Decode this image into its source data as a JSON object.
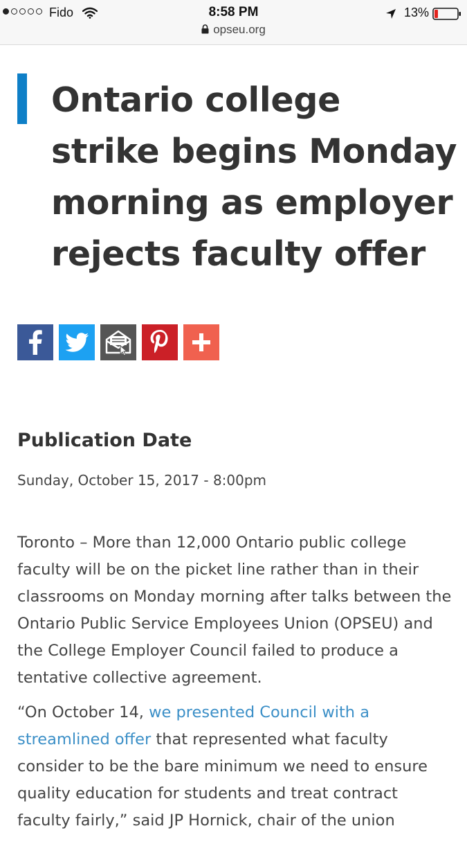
{
  "status_bar": {
    "carrier": "Fido",
    "time": "8:58 PM",
    "battery": "13%"
  },
  "address_bar": {
    "url": "opseu.org"
  },
  "article": {
    "title": "Ontario college strike begins Monday morning as employer rejects faculty offer",
    "share_buttons": [
      {
        "name": "facebook",
        "icon": "facebook-icon",
        "color": "#3b5998"
      },
      {
        "name": "twitter",
        "icon": "twitter-icon",
        "color": "#1da1f2"
      },
      {
        "name": "email",
        "icon": "email-icon",
        "color": "#555555"
      },
      {
        "name": "pinterest",
        "icon": "pinterest-icon",
        "color": "#cb2027"
      },
      {
        "name": "more",
        "icon": "plus-icon",
        "color": "#f0614f"
      }
    ],
    "publication_heading": "Publication Date",
    "publication_date": "Sunday, October 15, 2017 - 8:00pm",
    "paragraph1": "Toronto – More than 12,000 Ontario public college faculty will be on the picket line rather than in their classrooms on Monday morning after talks between the Ontario Public Service Employees Union (OPSEU) and the College Employer Council failed to produce a tentative collective agreement.",
    "paragraph2_start": "“On October 14, ",
    "paragraph2_link": "we presented Council with a streamlined offer",
    "paragraph2_end": " that represented what faculty consider to be the bare minimum we need to ensure quality education for students and treat contract faculty fairly,” said JP Hornick, chair of the union"
  },
  "colors": {
    "accent": "#0e7fc7",
    "link": "#3b8fc7",
    "text": "#333333"
  }
}
